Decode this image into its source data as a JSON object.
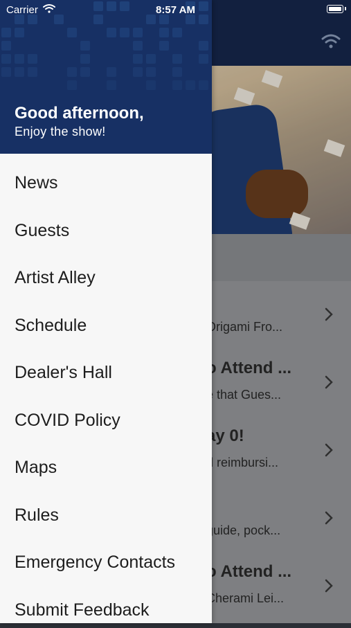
{
  "status_bar": {
    "carrier": "Carrier",
    "time": "8:57 AM"
  },
  "drawer": {
    "greeting": "Good afternoon,",
    "subgreeting": "Enjoy the show!",
    "menu_items": [
      {
        "label": "News"
      },
      {
        "label": "Guests"
      },
      {
        "label": "Artist Alley"
      },
      {
        "label": "Schedule"
      },
      {
        "label": "Dealer's Hall"
      },
      {
        "label": "COVID Policy"
      },
      {
        "label": "Maps"
      },
      {
        "label": "Rules"
      },
      {
        "label": "Emergency Contacts"
      },
      {
        "label": "Submit Feedback"
      }
    ]
  },
  "background_list": {
    "rows": [
      {
        "title": "!",
        "subtitle": "Origami Fro..."
      },
      {
        "title": "o Attend ...",
        "subtitle": "e that Gues..."
      },
      {
        "title": "ay 0!",
        "subtitle": "d reimbursi..."
      },
      {
        "title": "",
        "subtitle": "guide, pock..."
      },
      {
        "title": "o Attend ...",
        "subtitle": "Cherami Lei..."
      }
    ]
  },
  "colors": {
    "header_navy": "#16284d",
    "drawer_header": "#173064",
    "drawer_bg": "#f7f7f7",
    "menu_text": "#1d1d1d"
  }
}
